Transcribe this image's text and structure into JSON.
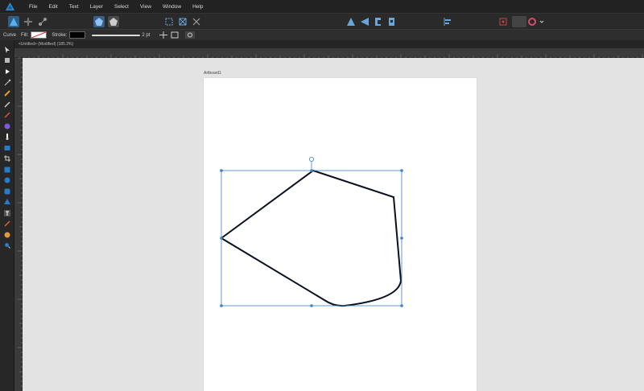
{
  "app": {
    "name": "Affinity Designer"
  },
  "menu": [
    "File",
    "Edit",
    "Text",
    "Layer",
    "Select",
    "View",
    "Window",
    "Help"
  ],
  "context": {
    "tool_name": "Curve",
    "fill_label": "Fill:",
    "stroke_label": "Stroke:",
    "stroke_width": "2 pt"
  },
  "document": {
    "tab_title": "<Untitled> (Modified) (185.3%)",
    "artboard_name": "Artboard1"
  },
  "colors": {
    "accent": "#2a8fd6",
    "selection": "#3d82c4",
    "canvas": "#e3e3e3",
    "artboard": "#ffffff",
    "stroke_swatch": "#000000"
  }
}
